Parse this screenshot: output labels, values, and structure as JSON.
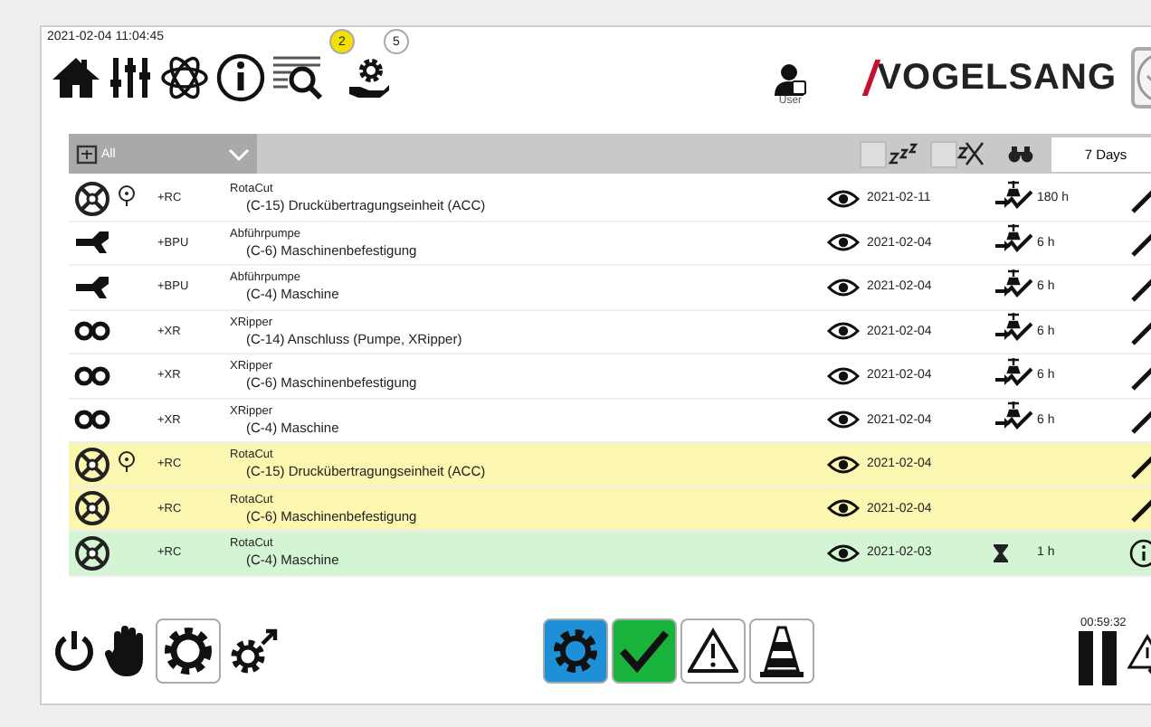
{
  "timestamp": "2021-02-04 11:04:45",
  "toolbar": {
    "badges": [
      {
        "count": "2",
        "kind": "alert"
      },
      {
        "count": "5",
        "kind": "info"
      }
    ]
  },
  "user": {
    "label": "User"
  },
  "logo": {
    "text": "VOGELSANG"
  },
  "filter": {
    "dropdown": "All",
    "sleep_checked": false,
    "hidden_checked": false,
    "period": "7 Days"
  },
  "rows": [
    {
      "kind": "rotor",
      "color": "#ffffff",
      "timer": true,
      "code": "+RC",
      "title": "RotaCut",
      "detail": "(C-15) Druckübertragungseinheit (ACC)",
      "date": "2021-02-11",
      "service": {
        "kind": "valve",
        "hours": "180 h"
      },
      "action": {
        "kind": "edit"
      }
    },
    {
      "kind": "pump",
      "color": "#ffffff",
      "timer": false,
      "code": "+BPU",
      "title": "Abführpumpe",
      "detail": "(C-6) Maschinenbefestigung",
      "date": "2021-02-04",
      "service": {
        "kind": "valve",
        "hours": "6 h"
      },
      "action": {
        "kind": "edit"
      }
    },
    {
      "kind": "pump",
      "color": "#ffffff",
      "timer": false,
      "code": "+BPU",
      "title": "Abführpumpe",
      "detail": "(C-4) Maschine",
      "date": "2021-02-04",
      "service": {
        "kind": "valve",
        "hours": "6 h"
      },
      "action": {
        "kind": "edit"
      }
    },
    {
      "kind": "ripper",
      "color": "#ffffff",
      "timer": false,
      "code": "+XR",
      "title": "XRipper",
      "detail": "(C-14) Anschluss (Pumpe, XRipper)",
      "date": "2021-02-04",
      "service": {
        "kind": "valve",
        "hours": "6 h"
      },
      "action": {
        "kind": "edit"
      }
    },
    {
      "kind": "ripper",
      "color": "#ffffff",
      "timer": false,
      "code": "+XR",
      "title": "XRipper",
      "detail": "(C-6) Maschinenbefestigung",
      "date": "2021-02-04",
      "service": {
        "kind": "valve",
        "hours": "6 h"
      },
      "action": {
        "kind": "edit"
      }
    },
    {
      "kind": "ripper",
      "color": "#ffffff",
      "timer": false,
      "code": "+XR",
      "title": "XRipper",
      "detail": "(C-4) Maschine",
      "date": "2021-02-04",
      "service": {
        "kind": "valve",
        "hours": "6 h"
      },
      "action": {
        "kind": "edit"
      }
    },
    {
      "kind": "rotor",
      "color": "#fbf6b0",
      "timer": true,
      "code": "+RC",
      "title": "RotaCut",
      "detail": "(C-15) Druckübertragungseinheit (ACC)",
      "date": "2021-02-04",
      "action": {
        "kind": "edit"
      }
    },
    {
      "kind": "rotor",
      "color": "#fbf6b0",
      "timer": false,
      "code": "+RC",
      "title": "RotaCut",
      "detail": "(C-6) Maschinenbefestigung",
      "date": "2021-02-04",
      "action": {
        "kind": "edit"
      }
    },
    {
      "kind": "rotor",
      "color": "#d3f5d3",
      "timer": false,
      "code": "+RC",
      "title": "RotaCut",
      "detail": "(C-4) Maschine",
      "date": "2021-02-03",
      "service": {
        "kind": "hourglass",
        "hours": "1 h"
      },
      "action": {
        "kind": "info"
      }
    }
  ],
  "bottom": {
    "modes": [
      {
        "kind": "auto",
        "active": true
      },
      {
        "kind": "ok",
        "active": true
      },
      {
        "kind": "warning",
        "active": false
      },
      {
        "kind": "cone",
        "active": false
      }
    ],
    "timer": "00:59:32"
  }
}
